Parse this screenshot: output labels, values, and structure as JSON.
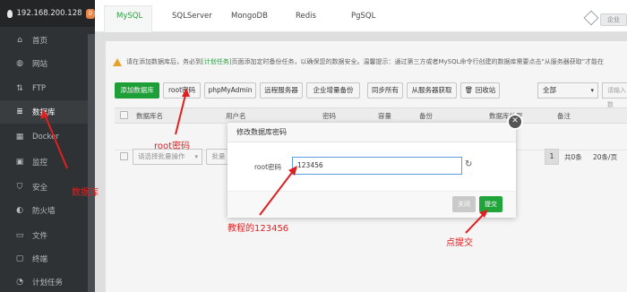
{
  "sidebar": {
    "ip": "192.168.200.128",
    "notification_count": "0",
    "items": [
      {
        "label": "首页",
        "icon": "home-icon"
      },
      {
        "label": "网站",
        "icon": "globe-icon"
      },
      {
        "label": "FTP",
        "icon": "ftp-icon"
      },
      {
        "label": "数据库",
        "icon": "database-icon"
      },
      {
        "label": "Docker",
        "icon": "docker-icon"
      },
      {
        "label": "监控",
        "icon": "monitor-icon"
      },
      {
        "label": "安全",
        "icon": "shield-icon"
      },
      {
        "label": "防火墙",
        "icon": "firewall-icon"
      },
      {
        "label": "文件",
        "icon": "folder-icon"
      },
      {
        "label": "终端",
        "icon": "terminal-icon"
      },
      {
        "label": "计划任务",
        "icon": "clock-icon"
      }
    ]
  },
  "tabs": [
    "MySQL",
    "SQLServer",
    "MongoDB",
    "Redis",
    "PgSQL"
  ],
  "upgrade_label": "企业",
  "notice": {
    "prefix": "请在添加数据库后，务必到",
    "link": "[计划任务]",
    "suffix": "页面添加定时备份任务，以确保您的数据安全。温馨提示：通过第三方或者MySQL命令行创建的数据库需要点击\"从服务器获取\"才能在"
  },
  "toolbar": {
    "add_db": "添加数据库",
    "root_pwd": "root密码",
    "phpmyadmin": "phpMyAdmin",
    "remote_server": "远程服务器",
    "enterprise_backup": "企业增量备份",
    "sync_all": "同步所有",
    "fetch_from_server": "从服务器获取",
    "recycle_bin": "回收站",
    "filter_value": "全部",
    "search_placeholder": "请输入数"
  },
  "table": {
    "headers": [
      "数据库名",
      "用户名",
      "密码",
      "容量",
      "备份",
      "数据库位置",
      "备注"
    ]
  },
  "bottom": {
    "batch_select": "请选择批量操作",
    "batch_button": "批量",
    "page": "1",
    "total": "共0条",
    "per_page": "20条/页"
  },
  "modal": {
    "title": "修改数据库密码",
    "label": "root密码",
    "value": "123456",
    "close_label": "关闭",
    "submit_label": "提交"
  },
  "annotations": {
    "root_pwd": "root密码",
    "database": "数据库",
    "tutorial": "教程的123456",
    "submit": "点提交"
  },
  "colors": {
    "accent": "#20a53a",
    "annotation": "#e02020",
    "sidebar_bg": "#2f3234"
  }
}
